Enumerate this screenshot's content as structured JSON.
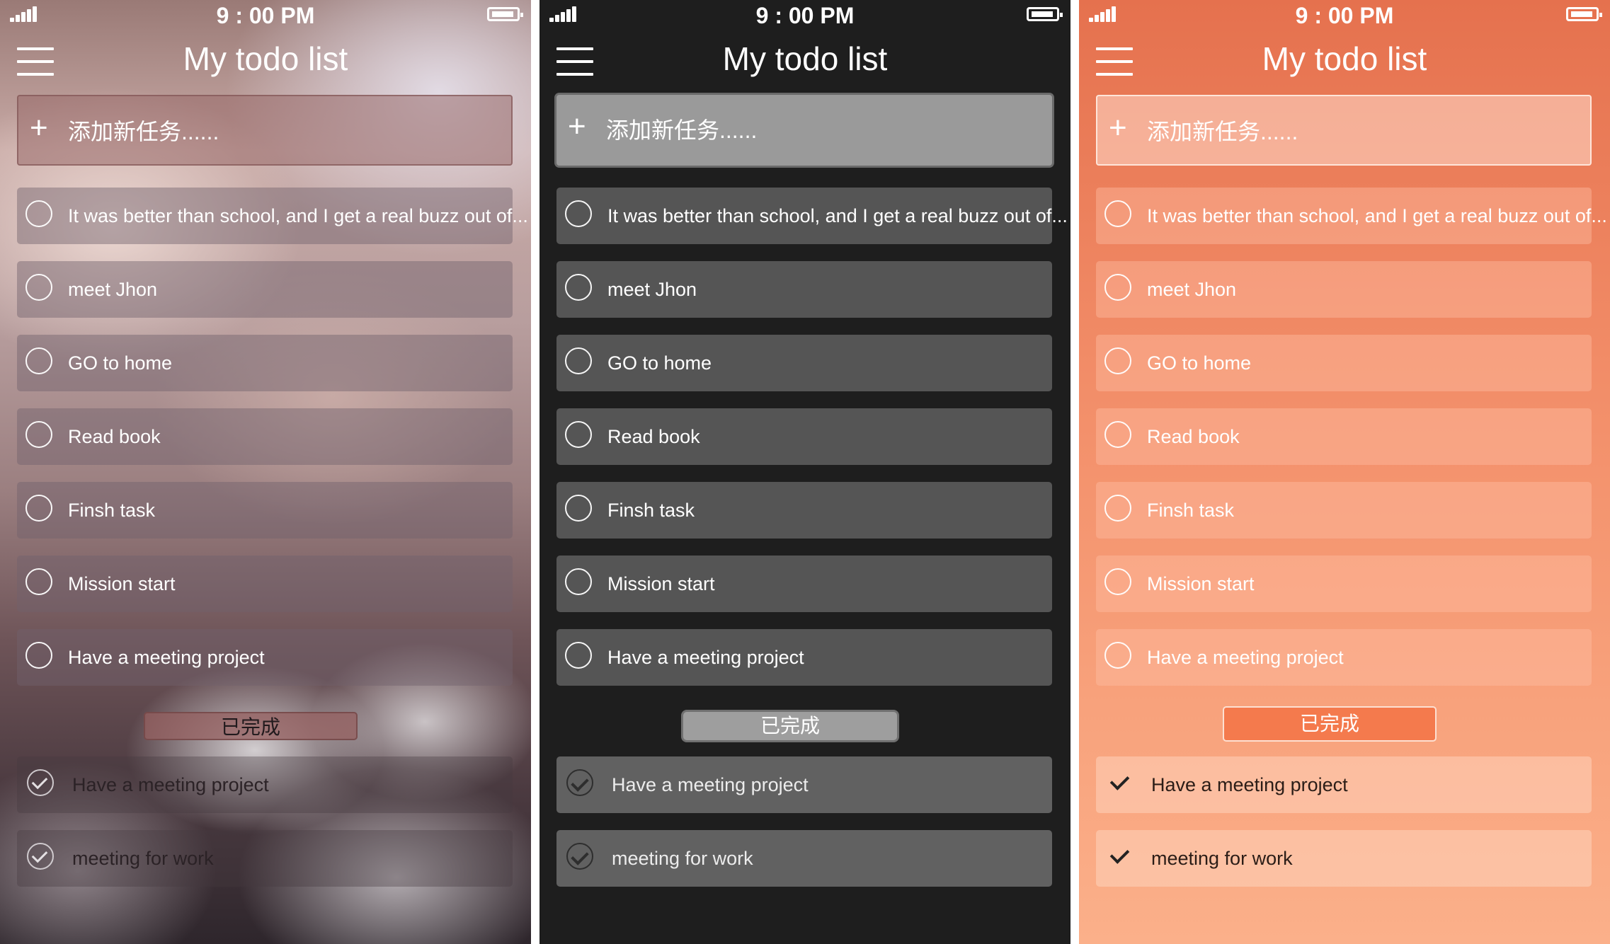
{
  "status_bar": {
    "time": "9 : 00 PM"
  },
  "header": {
    "title": "My todo list"
  },
  "add_task": {
    "placeholder": "添加新任务......"
  },
  "tasks": [
    "It was better than school, and I get a real buzz out of...",
    "meet Jhon",
    "GO to home",
    "Read book",
    "Finsh task",
    "Mission start",
    "Have a meeting project"
  ],
  "completed_label": "已完成",
  "completed": [
    "Have a meeting project",
    "meeting for work"
  ],
  "themes": [
    {
      "name": "blurred-photo"
    },
    {
      "name": "dark",
      "background": "#1e1e1e"
    },
    {
      "name": "coral",
      "background": "#f28d68"
    }
  ]
}
